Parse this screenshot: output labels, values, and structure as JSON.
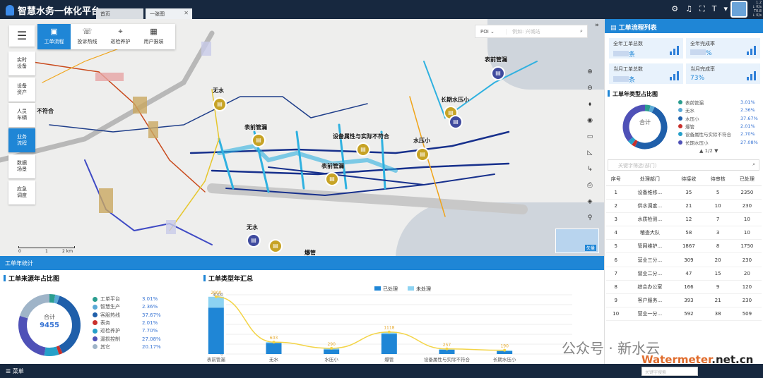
{
  "app": {
    "title": "智慧水务一体化平台"
  },
  "tabs": [
    {
      "label": "首页"
    },
    {
      "label": "一张图"
    }
  ],
  "network": {
    "lines": [
      "1.2",
      "↓ K/s",
      "T0.8",
      "↓ K/s"
    ]
  },
  "toolbar": {
    "items": [
      "工单流程",
      "投诉热线",
      "巡检养护",
      "用户报装"
    ]
  },
  "sidebar": {
    "items": [
      "实时\n设备",
      "设备\n资产",
      "人员\n车辆",
      "业务\n流程",
      "数据\n场景",
      "应急\n调度"
    ]
  },
  "map": {
    "poi_select": "POI",
    "search_placeholder": "例如: 兴城站",
    "labels": [
      "无水",
      "表前管漏",
      "设备属性与实际不符合",
      "表前管漏",
      "水压小",
      "表前管漏",
      "长期水压小",
      "无水",
      "爆管",
      "设备属性与实际不符合",
      "人员",
      "不符合"
    ],
    "scale": [
      "0",
      "1",
      "2 km"
    ],
    "minimap_label": "矢量"
  },
  "bottom_strip": {
    "title": "工单年统计"
  },
  "source_pie": {
    "title": "工单来源年占比图",
    "center_label": "合计",
    "total": "9455",
    "legend": [
      {
        "name": "工单平台",
        "pct": "3.01%",
        "color": "#2a9d8f"
      },
      {
        "name": "智慧生产",
        "pct": "2.36%",
        "color": "#5aa9d6"
      },
      {
        "name": "客服热线",
        "pct": "37.67%",
        "color": "#1f5faa"
      },
      {
        "name": "表务",
        "pct": "2.01%",
        "color": "#c9302c"
      },
      {
        "name": "巡检养护",
        "pct": "7.70%",
        "color": "#26a0c9"
      },
      {
        "name": "漏损控制",
        "pct": "27.08%",
        "color": "#4f51b7"
      },
      {
        "name": "其它",
        "pct": "20.17%",
        "color": "#9fb4c8"
      }
    ]
  },
  "type_chart": {
    "title": "工单类型年汇总",
    "legend": [
      "已处理",
      "未处理"
    ],
    "yticks": [
      "0",
      "500",
      "1000",
      "1500",
      "2000",
      "2500",
      "3000"
    ]
  },
  "chart_data": {
    "type": "bar",
    "categories": [
      "表前管漏",
      "无水",
      "水压小",
      "爆管",
      "设备属性与实际不符合",
      "长期水压小"
    ],
    "ylim": [
      0,
      3000
    ],
    "series": [
      {
        "name": "已处理",
        "values": [
          2350,
          560,
          230,
          1020,
          220,
          150
        ]
      },
      {
        "name": "未处理",
        "values": [
          550,
          43,
          60,
          98,
          37,
          40
        ]
      }
    ],
    "totals": [
      2900,
      603,
      290,
      1118,
      257,
      190
    ],
    "total_labels": [
      "2900",
      "603",
      "290",
      "1118",
      "257",
      "190"
    ]
  },
  "right_panel": {
    "title": "工单流程列表",
    "stats": [
      {
        "label": "全年工单总数",
        "value": "条"
      },
      {
        "label": "全年完成率",
        "value": "%"
      },
      {
        "label": "当月工单总数",
        "value": "条"
      },
      {
        "label": "当月完成率",
        "value": "73%"
      }
    ],
    "donut_title": "工单年类型占比图",
    "donut_center": "合计",
    "donut_legend": [
      {
        "name": "表前管漏",
        "pct": "3.01%",
        "color": "#2a9d8f"
      },
      {
        "name": "无水",
        "pct": "2.36%",
        "color": "#5aa9d6"
      },
      {
        "name": "水压小",
        "pct": "37.67%",
        "color": "#1f5faa"
      },
      {
        "name": "爆管",
        "pct": "2.01%",
        "color": "#c9302c"
      },
      {
        "name": "设备属性与实际不符合",
        "pct": "2.70%",
        "color": "#26a0c9"
      },
      {
        "name": "长期水压小",
        "pct": "27.08%",
        "color": "#4f51b7"
      }
    ],
    "pager": "1/2",
    "search_placeholder": "关键字筛选(部门)",
    "table": {
      "headers": [
        "序号",
        "处理部门",
        "待接收",
        "待审核",
        "已处理"
      ],
      "rows": [
        [
          "1",
          "设备维修...",
          "35",
          "5",
          "2350"
        ],
        [
          "2",
          "供水调度...",
          "21",
          "10",
          "230"
        ],
        [
          "3",
          "水质检测...",
          "12",
          "7",
          "10"
        ],
        [
          "4",
          "稽查大队",
          "58",
          "3",
          "10"
        ],
        [
          "5",
          "管网维护...",
          "1867",
          "8",
          "1750"
        ],
        [
          "6",
          "营业三分...",
          "309",
          "20",
          "230"
        ],
        [
          "7",
          "营业二分...",
          "47",
          "15",
          "20"
        ],
        [
          "8",
          "综合办公室",
          "166",
          "9",
          "120"
        ],
        [
          "9",
          "客户服务...",
          "393",
          "21",
          "230"
        ],
        [
          "10",
          "营业一分...",
          "592",
          "38",
          "509"
        ]
      ]
    }
  },
  "footer": {
    "menu": "菜单",
    "search_placeholder": "关键字搜索"
  },
  "watermark": {
    "text1": "公众号 · 新水云",
    "text2": "Watermeter",
    "text3": ".net.cn"
  }
}
